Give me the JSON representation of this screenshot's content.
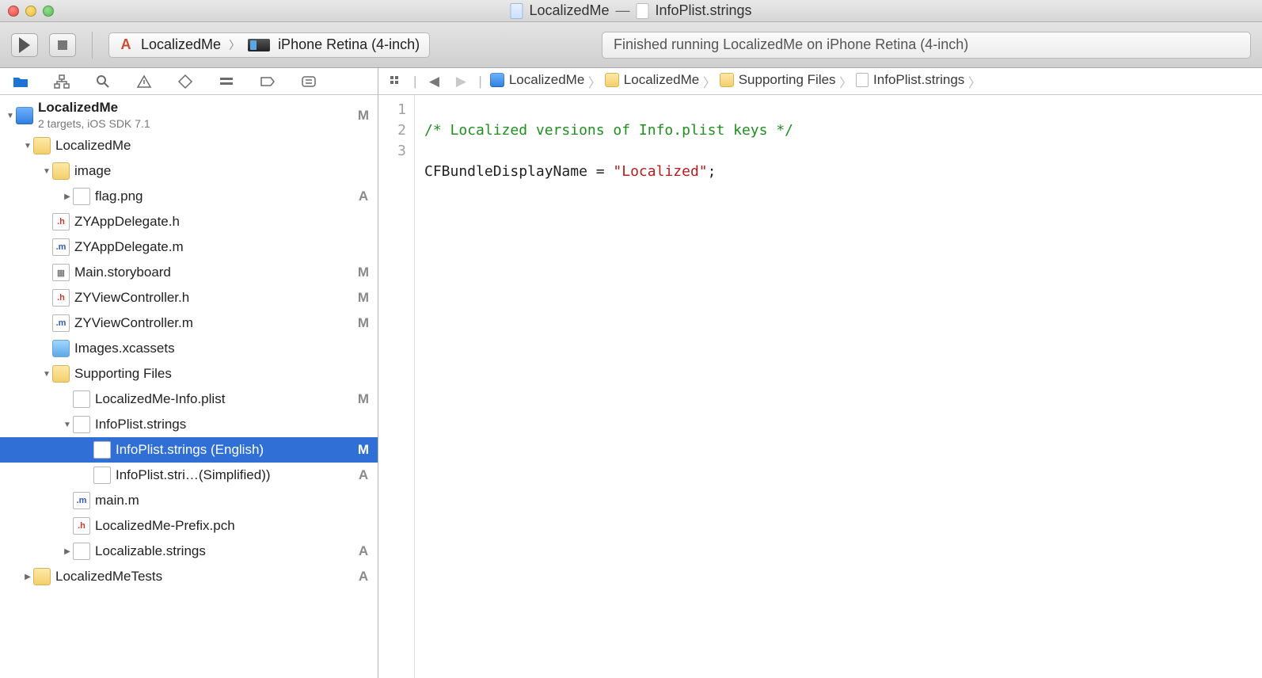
{
  "window": {
    "title_left": "LocalizedMe",
    "title_dash": "—",
    "title_right": "InfoPlist.strings"
  },
  "toolbar": {
    "scheme_target": "LocalizedMe",
    "scheme_device": "iPhone Retina (4-inch)",
    "activity": "Finished running LocalizedMe on iPhone Retina (4-inch)"
  },
  "navigator": {
    "project_name": "LocalizedMe",
    "project_subtitle": "2 targets, iOS SDK 7.1",
    "project_status": "M",
    "items": [
      {
        "depth": 1,
        "kind": "folder",
        "label": "LocalizedMe",
        "expanded": true
      },
      {
        "depth": 2,
        "kind": "folder",
        "label": "image",
        "expanded": true
      },
      {
        "depth": 3,
        "kind": "image",
        "label": "flag.png",
        "status": "A",
        "chev": "right"
      },
      {
        "depth": 2,
        "kind": "h",
        "label": "ZYAppDelegate.h"
      },
      {
        "depth": 2,
        "kind": "m",
        "label": "ZYAppDelegate.m"
      },
      {
        "depth": 2,
        "kind": "sb",
        "label": "Main.storyboard",
        "status": "M"
      },
      {
        "depth": 2,
        "kind": "h",
        "label": "ZYViewController.h",
        "status": "M"
      },
      {
        "depth": 2,
        "kind": "m",
        "label": "ZYViewController.m",
        "status": "M"
      },
      {
        "depth": 2,
        "kind": "xcassets",
        "label": "Images.xcassets"
      },
      {
        "depth": 2,
        "kind": "folder",
        "label": "Supporting Files",
        "expanded": true
      },
      {
        "depth": 3,
        "kind": "plist",
        "label": "LocalizedMe-Info.plist",
        "status": "M"
      },
      {
        "depth": 3,
        "kind": "strings",
        "label": "InfoPlist.strings",
        "expanded": true
      },
      {
        "depth": 4,
        "kind": "strings",
        "label": "InfoPlist.strings (English)",
        "status": "M",
        "selected": true
      },
      {
        "depth": 4,
        "kind": "strings",
        "label": "InfoPlist.stri…(Simplified))",
        "status": "A"
      },
      {
        "depth": 3,
        "kind": "m",
        "label": "main.m"
      },
      {
        "depth": 3,
        "kind": "h",
        "label": "LocalizedMe-Prefix.pch"
      },
      {
        "depth": 3,
        "kind": "strings",
        "label": "Localizable.strings",
        "status": "A",
        "chev": "right"
      },
      {
        "depth": 1,
        "kind": "folder",
        "label": "LocalizedMeTests",
        "chev": "right",
        "status": "A"
      }
    ]
  },
  "jumpbar": {
    "crumbs": [
      {
        "icon": "proj",
        "label": "LocalizedMe"
      },
      {
        "icon": "folder",
        "label": "LocalizedMe"
      },
      {
        "icon": "folder",
        "label": "Supporting Files"
      },
      {
        "icon": "file",
        "label": "InfoPlist.strings"
      }
    ]
  },
  "editor": {
    "line_numbers": [
      "1",
      "2",
      "3"
    ],
    "line1_comment": "/* Localized versions of Info.plist keys */",
    "line3_key": "CFBundleDisplayName",
    "line3_eq": " = ",
    "line3_value": "\"Localized\"",
    "line3_semi": ";"
  }
}
